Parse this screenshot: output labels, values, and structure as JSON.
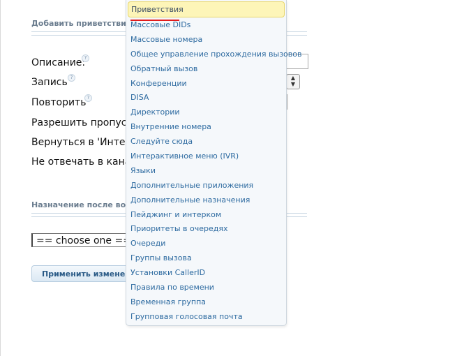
{
  "form": {
    "section_title": "Добавить приветствие",
    "labels": {
      "description": "Описание:",
      "recording": "Запись",
      "repeat": "Повторить",
      "allow_skip": "Разрешить пропусти",
      "return_ivr": "Вернуться в 'Интера",
      "no_answer": "Не отвечать в канал"
    },
    "destination_title": "Назначение после вос",
    "choose_value": "== choose one ==",
    "apply_label": "Применить изменени",
    "help_glyph": "?"
  },
  "dropdown": {
    "selected": "Приветствия",
    "items": [
      "Массовые DIDs",
      "Массовые номера",
      "Общее управление прохождения вызовов",
      "Обратный вызов",
      "Конференции",
      "DISA",
      "Директории",
      "Внутренние номера",
      "Следуйте сюда",
      "Интерактивное меню (IVR)",
      "Языки",
      "Дополнительные приложения",
      "Дополнительные назначения",
      "Пейджинг и интерком",
      "Приоритеты в очередях",
      "Очереди",
      "Группы вызова",
      "Установки CallerID",
      "Правила по времени",
      "Временная группа",
      "Групповая голосовая почта"
    ]
  }
}
